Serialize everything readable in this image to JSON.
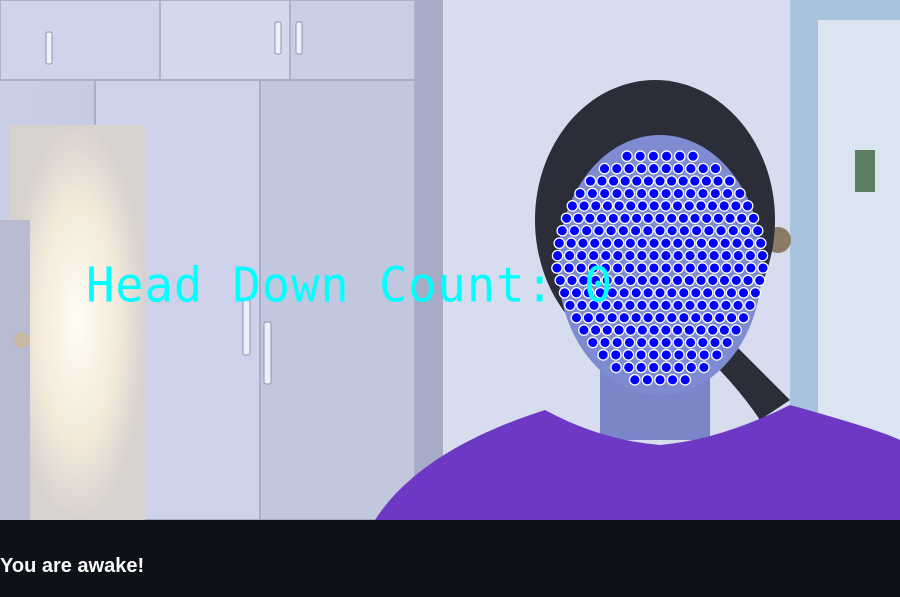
{
  "video": {
    "overlay_text": "Head Down Count: 0",
    "overlay_color": "#00ffff",
    "landmark_color": "#0000ff",
    "landmark_outline": "#ffffff",
    "landmark_icon": "face-mesh-landmarks"
  },
  "status": {
    "message": "You are awake!"
  },
  "colors": {
    "background": "#0e1117",
    "text": "#fafafa"
  }
}
